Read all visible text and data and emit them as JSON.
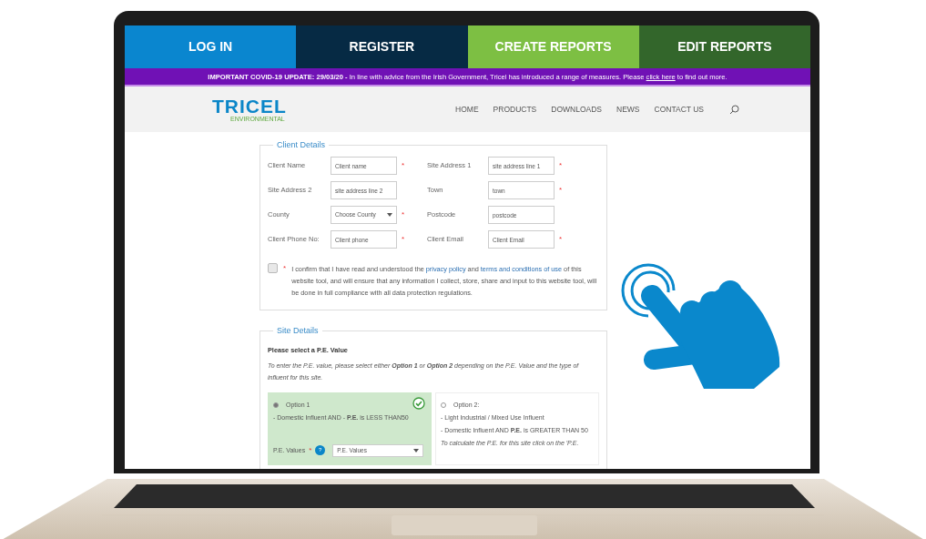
{
  "nav_tabs": [
    {
      "label": "LOG IN",
      "color": "#0a86cf"
    },
    {
      "label": "REGISTER",
      "color": "#062a44"
    },
    {
      "label": "CREATE REPORTS",
      "color": "#7dbf43"
    },
    {
      "label": "EDIT REPORTS",
      "color": "#33662b"
    }
  ],
  "notice": {
    "text": "**IMPORTANT COVID-19 UPDATE: 29/03/20 -** In line with advice from the Irish Government, Tricel has introduced a range of measures. Please",
    "link": "click here",
    "tail": "to find out more."
  },
  "header": {
    "logo": "TRICEL",
    "logo_sub": "ENVIRONMENTAL",
    "menu": [
      "HOME",
      "PRODUCTS",
      "DOWNLOADS",
      "NEWS",
      "CONTACT US"
    ]
  },
  "client_details": {
    "legend": "Client Details",
    "fields": [
      {
        "label": "Client Name",
        "kind": "text",
        "placeholder": "Client name",
        "required_mark": "*"
      },
      {
        "label": "Site Address 1",
        "kind": "text",
        "placeholder": "site address line 1",
        "required_mark": "*"
      },
      {
        "label": "Site Address 2",
        "kind": "text",
        "placeholder": "site address line 2"
      },
      {
        "label": "Town",
        "kind": "text",
        "placeholder": "town",
        "required_mark": "*"
      },
      {
        "label": "County",
        "kind": "select",
        "value": "Choose County",
        "required_mark": "*"
      },
      {
        "label": "Postcode",
        "kind": "text",
        "placeholder": "postcode"
      },
      {
        "label": "Client Phone No:",
        "kind": "text",
        "placeholder": "Client phone",
        "required_mark": "*"
      },
      {
        "label": "Client Email",
        "kind": "text",
        "placeholder": "Client Email",
        "required_mark": "*"
      }
    ],
    "consent": {
      "checked": false,
      "required_mark": "*",
      "text": "I confirm that I have read and understood the",
      "link1": "privacy policy",
      "mid": "and",
      "link2": "terms and conditions of use",
      "tail": "of this website tool, and will ensure that any information I collect, store, share and input to this website tool, will be done in full compliance with all data protection regulations."
    }
  },
  "site_details": {
    "legend": "Site Details",
    "heading": "Please select a P.E. Value",
    "intro": "To enter the P.E. value, please select either **Option 1** or **Option 2** depending on the P.E. Value and the type of influent for this site.",
    "options": [
      {
        "label": "Option 1",
        "selected": true,
        "lines": [
          "- Domestic Influent AND - **P.E.** is LESS THAN50"
        ],
        "select_label": "P.E. Values",
        "required_mark": "*",
        "help": "?",
        "select_value": "P.E. Values"
      },
      {
        "label": "Option 2:",
        "selected": false,
        "lines": [
          "- Light Industrial / Mixed Use Influent",
          "- Domestic Influent AND **P.E.** is GREATER THAN 50"
        ],
        "note": "To calculate the P.E. for this site click on the 'P.E."
      }
    ]
  }
}
